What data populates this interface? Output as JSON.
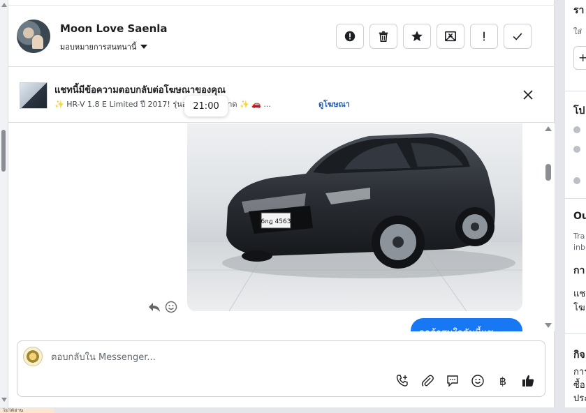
{
  "contact": {
    "name": "Moon Love Saenla",
    "assign_label": "มอบหมายการสนทนานี้"
  },
  "header_actions": [
    {
      "name": "spam-button",
      "icon": "alert-circle-icon"
    },
    {
      "name": "delete-button",
      "icon": "trash-icon"
    },
    {
      "name": "star-button",
      "icon": "star-icon"
    },
    {
      "name": "mark-unread-button",
      "icon": "mail-x-icon"
    },
    {
      "name": "follow-up-button",
      "icon": "exclamation-icon"
    },
    {
      "name": "done-button",
      "icon": "checkmark-icon"
    }
  ],
  "ad_reply": {
    "title": "แชทนี้มีข้อความตอบกลับต่อโฆษณาของคุณ",
    "subtitle": "✨ HR-V 1.8 E Limited ปี 2017! รุ่นอ           ้มที่สุดในตลาด ✨ 🚗 ...",
    "link_label": "ดูโฆษณา"
  },
  "timestamp_tooltip": "21:00",
  "messages": {
    "car_plate": "6กฎ 4563",
    "outgoing_preview": "ลูกค้าสนใจคันนี้แชะ"
  },
  "composer": {
    "placeholder": "ตอบกลับใน Messenger...",
    "tools": [
      "phone-plus-icon",
      "paperclip-icon",
      "speech-bubble-icon",
      "smiley-icon",
      "baht-icon",
      "thumbs-up-icon"
    ],
    "baht_symbol": "฿"
  },
  "right_panel": {
    "section_1": "รา",
    "input_hint": "ใส่",
    "add_symbol": "+",
    "section_2": "โป",
    "section_3": "Ou",
    "section_3_text_1": "Tra",
    "section_3_text_2": "inb",
    "section_4": "กา",
    "section_4_text_1": "แช",
    "section_4_text_2": "โฆ",
    "section_5": "กิจ",
    "section_5_text_1": "การ",
    "section_5_text_2": "ซื้อ",
    "section_5_text_3": "ประ"
  },
  "bottom_tab_label": "ไม่ได้อ่าน"
}
